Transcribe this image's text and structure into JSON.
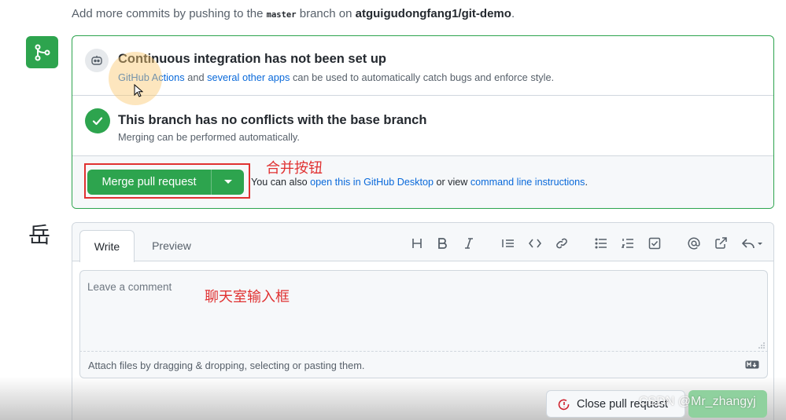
{
  "top": {
    "prefix": "Add more commits by pushing to the",
    "branch": "master",
    "middle": "branch on",
    "repo": "atguigudongfang1/git-demo",
    "suffix": "."
  },
  "merge_panel": {
    "icon": "git-merge-icon",
    "ci": {
      "icon": "robot-icon",
      "title": "Continuous integration has not been set up",
      "link1": "GitHub Actions",
      "and": "and",
      "link2": "several other apps",
      "rest": "can be used to automatically catch bugs and enforce style."
    },
    "conflicts": {
      "icon": "check-icon",
      "title": "This branch has no conflicts with the base branch",
      "desc": "Merging can be performed automatically."
    },
    "action": {
      "merge_label": "Merge pull request",
      "caret_icon": "triangle-down-icon",
      "also_prefix": "You can also",
      "link_desktop": "open this in GitHub Desktop",
      "or_view": "or view",
      "link_cli": "command line instructions",
      "period": ".",
      "annotation": "合并按钮",
      "annotation_color": "#e03131"
    }
  },
  "comment": {
    "avatar_char": "岳",
    "tabs": [
      "Write",
      "Preview"
    ],
    "toolbar": [
      "heading-icon",
      "bold-icon",
      "italic-icon",
      "quote-icon",
      "code-icon",
      "link-icon",
      "unordered-list-icon",
      "ordered-list-icon",
      "task-list-icon",
      "mention-icon",
      "cross-reference-icon",
      "reply-icon"
    ],
    "placeholder": "Leave a comment",
    "annotation": "聊天室输入框",
    "attach_text": "Attach files by dragging & dropping, selecting or pasting them.",
    "close_label": "Close pull request",
    "comment_label": "Comment",
    "watermark": "CSDN @Mr_zhangyj"
  },
  "colors": {
    "accent_green": "#2da44e",
    "link_blue": "#0969da",
    "annotation_red": "#e03131"
  }
}
